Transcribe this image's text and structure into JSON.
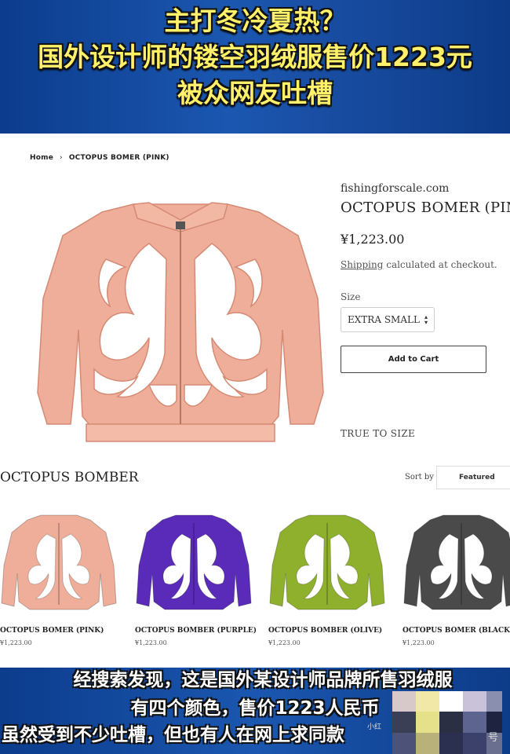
{
  "banner": {
    "line1": "主打冬冷夏热？",
    "line2": "国外设计师的镂空羽绒服售价1223元",
    "line3": "被众网友吐槽"
  },
  "breadcrumb": {
    "home": "Home",
    "separator": "›",
    "current": "OCTOPUS BOMER (PINK)"
  },
  "product": {
    "vendor": "fishingforscale.com",
    "title": "OCTOPUS BOMER (PIN",
    "price": "¥1,223.00",
    "shipping_link": "Shipping",
    "shipping_text": " calculated at checkout.",
    "size_label": "Size",
    "size_value": "EXTRA SMALL",
    "add_to_cart": "Add to Cart",
    "fit_note": "TRUE TO SIZE"
  },
  "collection": {
    "title": "OCTOPUS BOMBER",
    "sort_label": "Sort by",
    "sort_value": "Featured",
    "items": [
      {
        "name": "OCTOPUS BOMER (PINK)",
        "price": "¥1,223.00",
        "color": "#efae9a"
      },
      {
        "name": "OCTOPUS BOMBER (PURPLE)",
        "price": "¥1,223.00",
        "color": "#5a2bb8"
      },
      {
        "name": "OCTOPUS BOMBER (OLIVE)",
        "price": "¥1,223.00",
        "color": "#8fb02c"
      },
      {
        "name": "OCTOPUS BOMER (BLACK",
        "price": "¥1,223.00",
        "color": "#4a4a4a"
      }
    ]
  },
  "subtitles": {
    "line1": "经搜索发现，这是国外某设计师品牌所售羽绒服",
    "line2": "有四个颜色，售价1223人民币",
    "line3": "虽然受到不少吐槽，但也有人在网上求同款"
  },
  "watermark": {
    "text1": "小红",
    "text2": "号"
  },
  "colors": {
    "banner_blue": "#1b57b0",
    "headline_yellow": "#fff06a"
  }
}
